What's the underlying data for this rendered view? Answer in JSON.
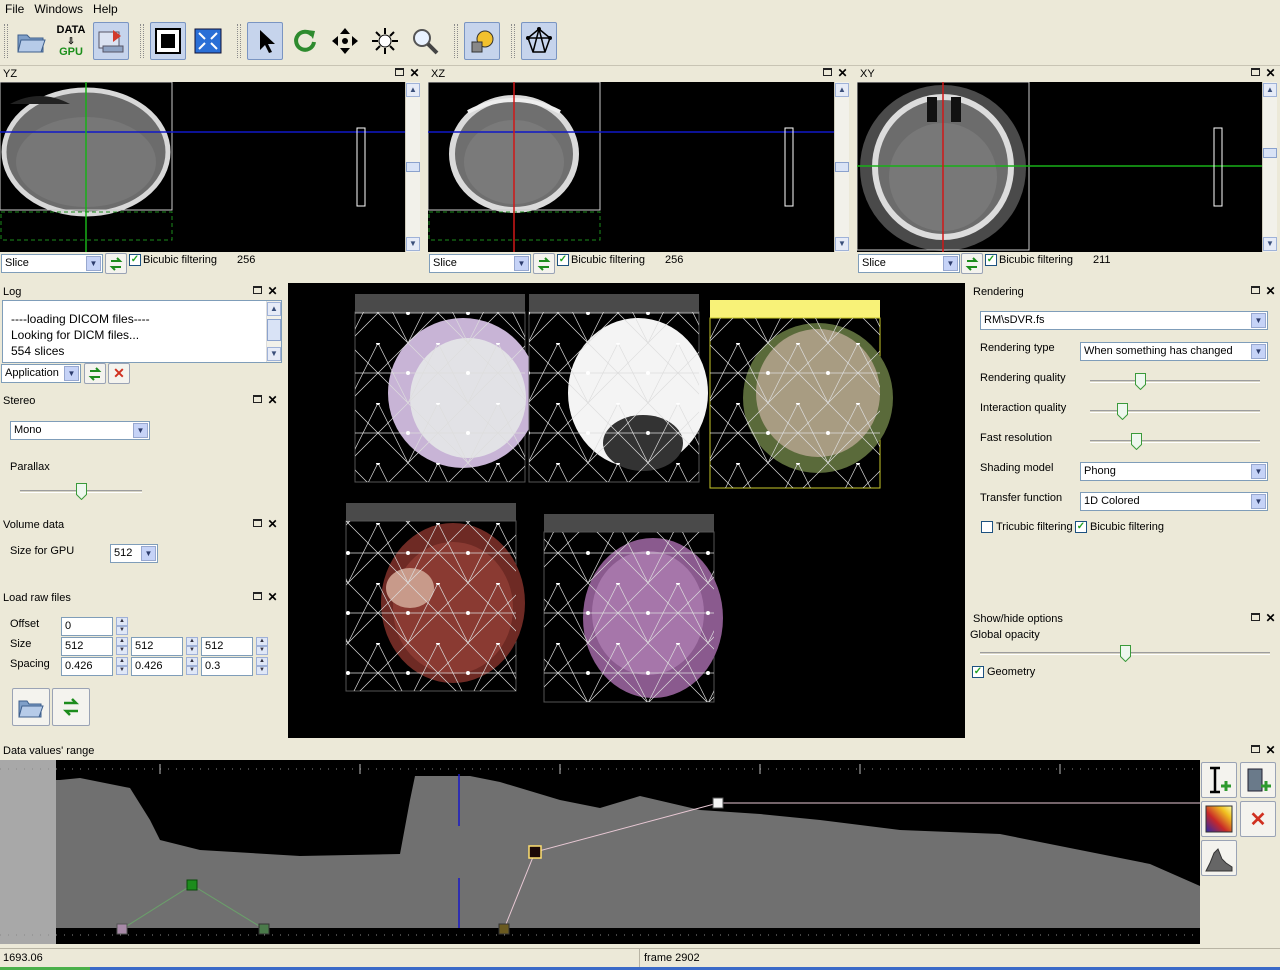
{
  "menu": [
    "File",
    "Windows",
    "Help"
  ],
  "toolbar": {
    "data_gpu_top": "DATA",
    "data_gpu_bottom": "GPU",
    "buttons": [
      "open-folder-icon",
      "data-to-gpu-icon",
      "load-icon",
      "fit-view-icon",
      "maximize-view-icon",
      "select-arrow-icon",
      "rotate-icon",
      "pan-icon",
      "brightness-icon",
      "zoom-icon",
      "light-icon",
      "geometry-icon"
    ]
  },
  "views": [
    {
      "title": "YZ",
      "mode": "Slice",
      "bicubic": "Bicubic filtering",
      "count": "256"
    },
    {
      "title": "XZ",
      "mode": "Slice",
      "bicubic": "Bicubic filtering",
      "count": "256"
    },
    {
      "title": "XY",
      "mode": "Slice",
      "bicubic": "Bicubic filtering",
      "count": "211"
    }
  ],
  "log": {
    "title": "Log",
    "lines": [
      "----loading DICOM files----",
      "Looking for DICM files...",
      "554 slices"
    ],
    "filter": "Application"
  },
  "stereo": {
    "title": "Stereo",
    "mode": "Mono",
    "parallax_label": "Parallax",
    "parallax": 0.5
  },
  "volume": {
    "title": "Volume data",
    "size_label": "Size for GPU",
    "size": "512"
  },
  "raw": {
    "title": "Load raw files",
    "offset_label": "Offset",
    "offset": "0",
    "size_label": "Size",
    "size": [
      "512",
      "512",
      "512"
    ],
    "spacing_label": "Spacing",
    "spacing": [
      "0.426",
      "0.426",
      "0.3"
    ]
  },
  "rendering": {
    "title": "Rendering",
    "shader": "RM\\sDVR.fs",
    "type_label": "Rendering type",
    "type": "When something has changed",
    "quality_label": "Rendering quality",
    "quality": 0.28,
    "interaction_label": "Interaction quality",
    "interaction": 0.17,
    "fast_label": "Fast resolution",
    "fast": 0.26,
    "shading_label": "Shading model",
    "shading": "Phong",
    "transfer_label": "Transfer function",
    "transfer": "1D Colored",
    "tricubic": "Tricubic filtering",
    "bicubic": "Bicubic filtering"
  },
  "showhide": {
    "title": "Show/hide options",
    "opacity_label": "Global opacity",
    "opacity": 0.5,
    "geometry": "Geometry"
  },
  "range": {
    "title": "Data values' range"
  },
  "status": {
    "value": "1693.06",
    "frame": "frame 2902"
  }
}
